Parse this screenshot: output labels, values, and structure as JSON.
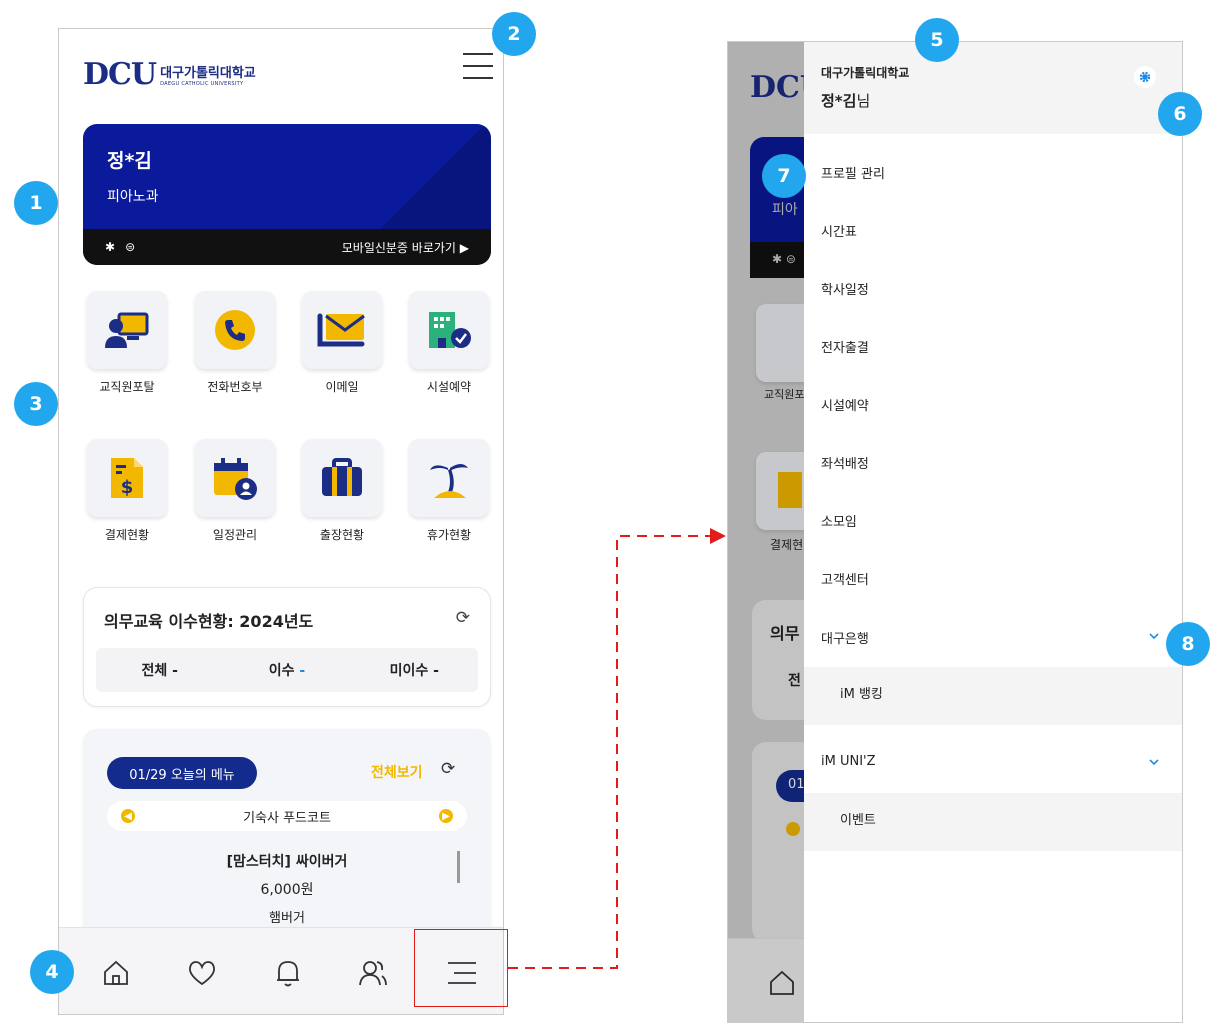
{
  "left_phone": {
    "logo": {
      "mark": "DCU",
      "name_ko": "대구가톨릭대학교",
      "name_en": "DAEGU CATHOLIC UNIVERSITY"
    },
    "id_card": {
      "name": "정*김",
      "department": "피아노과",
      "link_label": "모바일신분증 바로가기 ▶",
      "icons": [
        "bluetooth-icon",
        "nfc-icon"
      ]
    },
    "quick_menu": [
      {
        "label": "교직원포탈",
        "icon": "portal-icon"
      },
      {
        "label": "전화번호부",
        "icon": "phone-icon"
      },
      {
        "label": "이메일",
        "icon": "mail-icon"
      },
      {
        "label": "시설예약",
        "icon": "building-check-icon"
      },
      {
        "label": "결제현황",
        "icon": "invoice-icon"
      },
      {
        "label": "일정관리",
        "icon": "calendar-user-icon"
      },
      {
        "label": "출장현황",
        "icon": "briefcase-icon"
      },
      {
        "label": "휴가현황",
        "icon": "island-icon"
      }
    ],
    "education": {
      "title": "의무교육 이수현황: 2024년도",
      "total_label": "전체",
      "total_value": "-",
      "done_label": "이수",
      "done_value": "-",
      "undone_label": "미이수",
      "undone_value": "-"
    },
    "today_menu": {
      "date_pill": "01/29 오늘의 메뉴",
      "view_all": "전체보기",
      "restaurant": "기숙사 푸드코트",
      "dish": "[맘스터치]  싸이버거",
      "price": "6,000원",
      "category": "햄버거"
    },
    "tabbar": [
      "home-icon",
      "heart-icon",
      "bell-icon",
      "users-icon",
      "menu-icon"
    ]
  },
  "right_phone": {
    "ghost_text": {
      "logo": "DCU",
      "dept_partial": "피아",
      "portal_partial": "교직원포",
      "payment_partial": "결제현",
      "edu_partial": "의무",
      "total_partial": "전",
      "menu_partial": "01"
    },
    "drawer": {
      "university": "대구가톨릭대학교",
      "user_name": "정*김",
      "user_suffix": "님",
      "items": [
        "프로필 관리",
        "시간표",
        "학사일정",
        "전자출결",
        "시설예약",
        "좌석배정",
        "소모임",
        "고객센터"
      ],
      "groups": [
        {
          "label": "대구은행",
          "sub": "iM 뱅킹"
        },
        {
          "label": "iM UNI'Z",
          "sub": "이벤트"
        }
      ]
    }
  },
  "badges": [
    "1",
    "2",
    "3",
    "4",
    "5",
    "6",
    "7",
    "8"
  ],
  "colors": {
    "navy": "#1c2d86",
    "card_blue": "#0a1a9a",
    "accent_yellow": "#f2b800",
    "badge_blue": "#22a7ee",
    "connector_red": "#e41b1b"
  }
}
